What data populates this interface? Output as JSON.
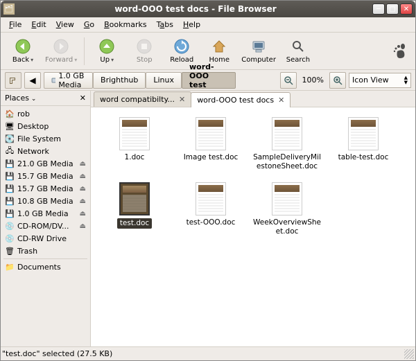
{
  "window": {
    "title": "word-OOO test docs - File Browser"
  },
  "menu": {
    "file": "File",
    "edit": "Edit",
    "view": "View",
    "go": "Go",
    "bookmarks": "Bookmarks",
    "tabs": "Tabs",
    "help": "Help"
  },
  "toolbar": {
    "back": "Back",
    "forward": "Forward",
    "up": "Up",
    "stop": "Stop",
    "reload": "Reload",
    "home": "Home",
    "computer": "Computer",
    "search": "Search"
  },
  "location": {
    "crumbs": [
      {
        "label": "1.0 GB Media",
        "icon": "drive"
      },
      {
        "label": "Brighthub"
      },
      {
        "label": "Linux"
      },
      {
        "label": "word-OOO test docs",
        "active": true
      }
    ],
    "zoom": "100%",
    "view_mode": "Icon View"
  },
  "sidebar": {
    "header": "Places",
    "items": [
      {
        "label": "rob",
        "icon": "home"
      },
      {
        "label": "Desktop",
        "icon": "desktop"
      },
      {
        "label": "File System",
        "icon": "disk"
      },
      {
        "label": "Network",
        "icon": "network"
      },
      {
        "label": "21.0 GB Media",
        "icon": "drive",
        "eject": true
      },
      {
        "label": "15.7 GB Media",
        "icon": "drive",
        "eject": true
      },
      {
        "label": "15.7 GB Media",
        "icon": "drive",
        "eject": true
      },
      {
        "label": "10.8 GB Media",
        "icon": "drive",
        "eject": true
      },
      {
        "label": "1.0 GB Media",
        "icon": "drive",
        "eject": true
      },
      {
        "label": "CD-ROM/DV...",
        "icon": "cd",
        "eject": true
      },
      {
        "label": "CD-RW Drive",
        "icon": "cd"
      },
      {
        "label": "Trash",
        "icon": "trash"
      }
    ],
    "bookmarks": [
      {
        "label": "Documents",
        "icon": "folder"
      }
    ]
  },
  "tabs": [
    {
      "label": "word compatibilty...",
      "active": false
    },
    {
      "label": "word-OOO test docs",
      "active": true
    }
  ],
  "files": [
    {
      "name": "1.doc"
    },
    {
      "name": "Image test.doc"
    },
    {
      "name": "SampleDeliveryMilestoneSheet.doc"
    },
    {
      "name": "table-test.doc"
    },
    {
      "name": "test.doc",
      "selected": true
    },
    {
      "name": "test-OOO.doc"
    },
    {
      "name": "WeekOverviewSheet.doc"
    }
  ],
  "status": "\"test.doc\" selected (27.5 KB)"
}
